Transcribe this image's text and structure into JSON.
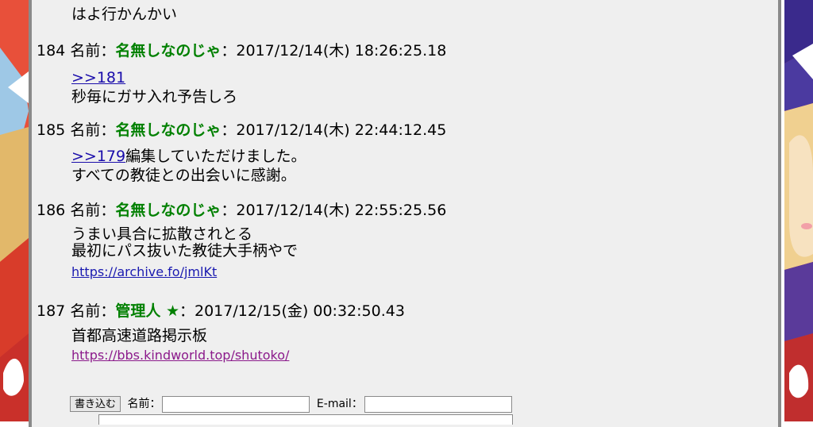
{
  "prev_tail": "はよ行かんかい",
  "posts": [
    {
      "number": "184",
      "name_label": "名前：",
      "name": "名無しなのじゃ",
      "sep": "：",
      "date": "2017/12/14(木) 18:26:25.18",
      "anchor": ">>181",
      "lines": [
        "秒毎にガサ入れ予告しろ"
      ]
    },
    {
      "number": "185",
      "name_label": "名前：",
      "name": "名無しなのじゃ",
      "sep": "：",
      "date": "2017/12/14(木) 22:44:12.45",
      "anchor": ">>179",
      "anchor_text": "編集していただけました。",
      "lines": [
        "すべての教徒との出会いに感謝。"
      ]
    },
    {
      "number": "186",
      "name_label": "名前：",
      "name": "名無しなのじゃ",
      "sep": "：",
      "date": "2017/12/14(木) 22:55:25.56",
      "lines": [
        "うまい具合に拡散されとる",
        "最初にパス抜いた教徒大手柄やで"
      ],
      "link": "https://archive.fo/jmlKt"
    },
    {
      "number": "187",
      "name_label": "名前：",
      "name": "管理人 ★",
      "sep": "：",
      "date": "2017/12/15(金) 00:32:50.43",
      "lines": [
        "首都高速道路掲示板"
      ],
      "link": "https://bbs.kindworld.top/shutoko/"
    }
  ],
  "form": {
    "submit_label": "書き込む",
    "name_label": "名前：",
    "email_label": "E-mail：",
    "name_value": "",
    "email_value": ""
  },
  "colors": {
    "name_green": "#008000",
    "panel_bg": "#efefef",
    "link_blue": "#1a0dab",
    "visited_purple": "#8b1a8b"
  }
}
